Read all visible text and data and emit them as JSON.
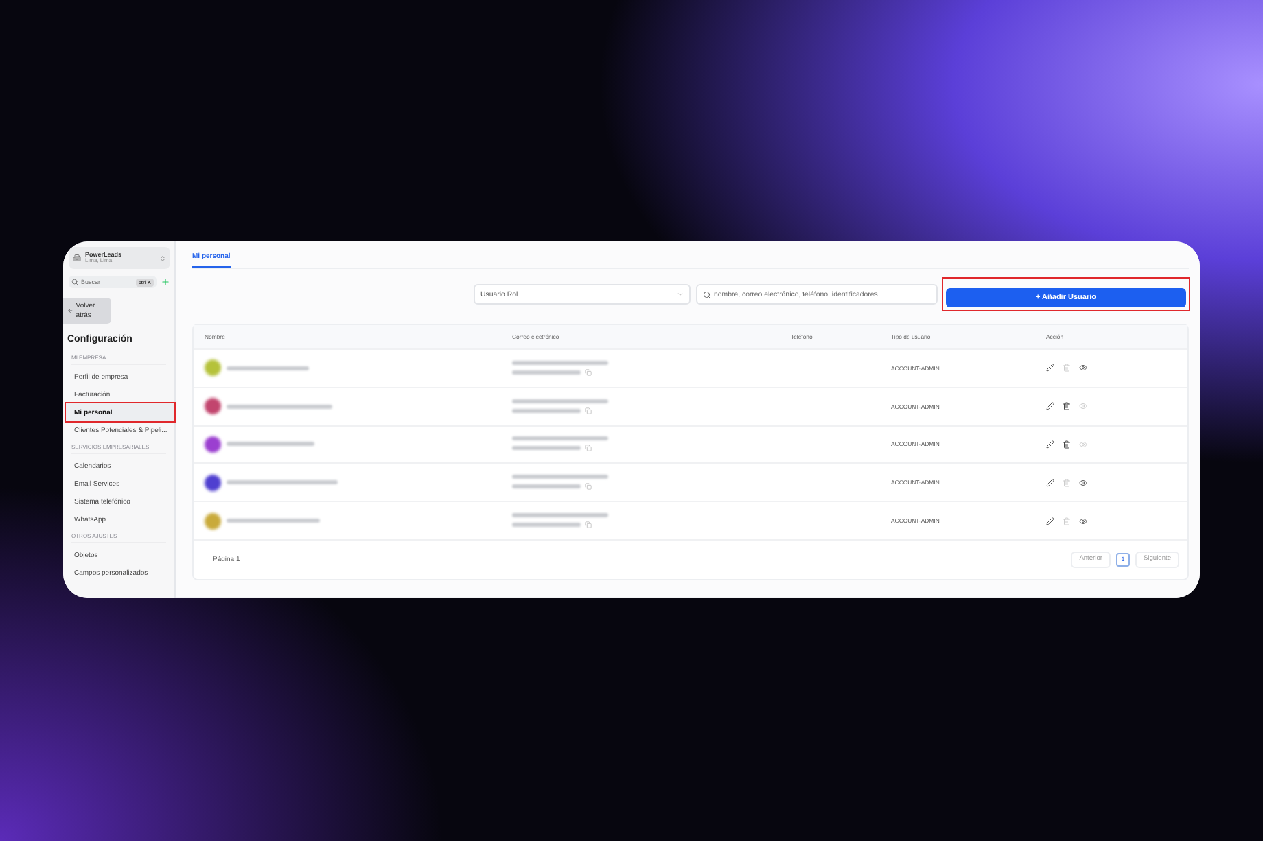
{
  "account": {
    "name": "PowerLeads",
    "location": "Lima, Lima"
  },
  "search": {
    "placeholder": "Buscar",
    "shortcut": "ctrl K"
  },
  "back_button": "Volver atrás",
  "sidebar": {
    "title": "Configuración",
    "sections": [
      {
        "heading": "MI EMPRESA",
        "items": [
          {
            "label": "Perfil de empresa",
            "selected": false,
            "highlighted": false
          },
          {
            "label": "Facturación",
            "selected": false,
            "highlighted": false
          },
          {
            "label": "Mi personal",
            "selected": true,
            "highlighted": true
          },
          {
            "label": "Clientes Potenciales & Pipeli...",
            "selected": false,
            "highlighted": false
          }
        ]
      },
      {
        "heading": "SERVICIOS EMPRESARIALES",
        "items": [
          {
            "label": "Calendarios",
            "selected": false,
            "highlighted": false
          },
          {
            "label": "Email Services",
            "selected": false,
            "highlighted": false
          },
          {
            "label": "Sistema telefónico",
            "selected": false,
            "highlighted": false
          },
          {
            "label": "WhatsApp",
            "selected": false,
            "highlighted": false
          }
        ]
      },
      {
        "heading": "OTROS AJUSTES",
        "items": [
          {
            "label": "Objetos",
            "selected": false,
            "highlighted": false
          },
          {
            "label": "Campos personalizados",
            "selected": false,
            "highlighted": false
          }
        ]
      }
    ]
  },
  "tabs": [
    {
      "label": "Mi personal",
      "selected": true
    }
  ],
  "role_filter": {
    "placeholder": "Usuario Rol"
  },
  "user_search": {
    "placeholder": "nombre, correo electrónico, teléfono, identificadores"
  },
  "add_button": {
    "label": "+ Añadir Usuario",
    "highlighted": true
  },
  "table": {
    "columns": [
      "Nombre",
      "Correo electrónico",
      "Teléfono",
      "Tipo de usuario",
      "Acción"
    ],
    "rows": [
      {
        "color": "#b5c23a",
        "type": "ACCOUNT-ADMIN",
        "can_delete": false,
        "can_view": true
      },
      {
        "color": "#c2456e",
        "type": "ACCOUNT-ADMIN",
        "can_delete": true,
        "can_view": false
      },
      {
        "color": "#9b3fd0",
        "type": "ACCOUNT-ADMIN",
        "can_delete": true,
        "can_view": false
      },
      {
        "color": "#4f3fd0",
        "type": "ACCOUNT-ADMIN",
        "can_delete": false,
        "can_view": true
      },
      {
        "color": "#c9aa3a",
        "type": "ACCOUNT-ADMIN",
        "can_delete": false,
        "can_view": true
      }
    ]
  },
  "pagination": {
    "page_label": "Página 1",
    "previous": "Anterior",
    "pages": [
      {
        "label": "1",
        "selected": true
      }
    ],
    "next": "Siguiente"
  }
}
